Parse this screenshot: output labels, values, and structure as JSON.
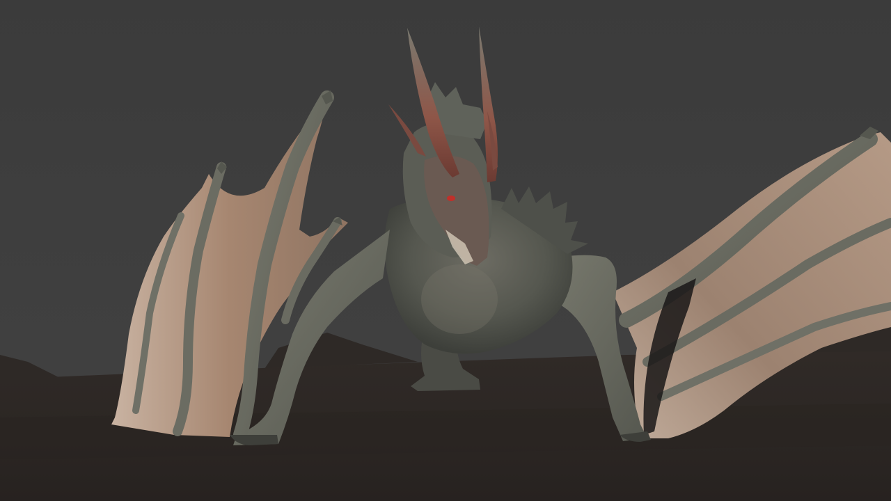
{
  "scene": {
    "colors": {
      "sky": "#3d3d3d",
      "ground": "#2d2825",
      "hills": "#292421",
      "wing_membrane": "#b89a84",
      "wing_bone": "#6d6e63",
      "body_scale": "#5a5c55",
      "horn": "#8a4b3e",
      "eye": "#c0302a"
    },
    "icons": [
      "dragon-figure"
    ]
  }
}
